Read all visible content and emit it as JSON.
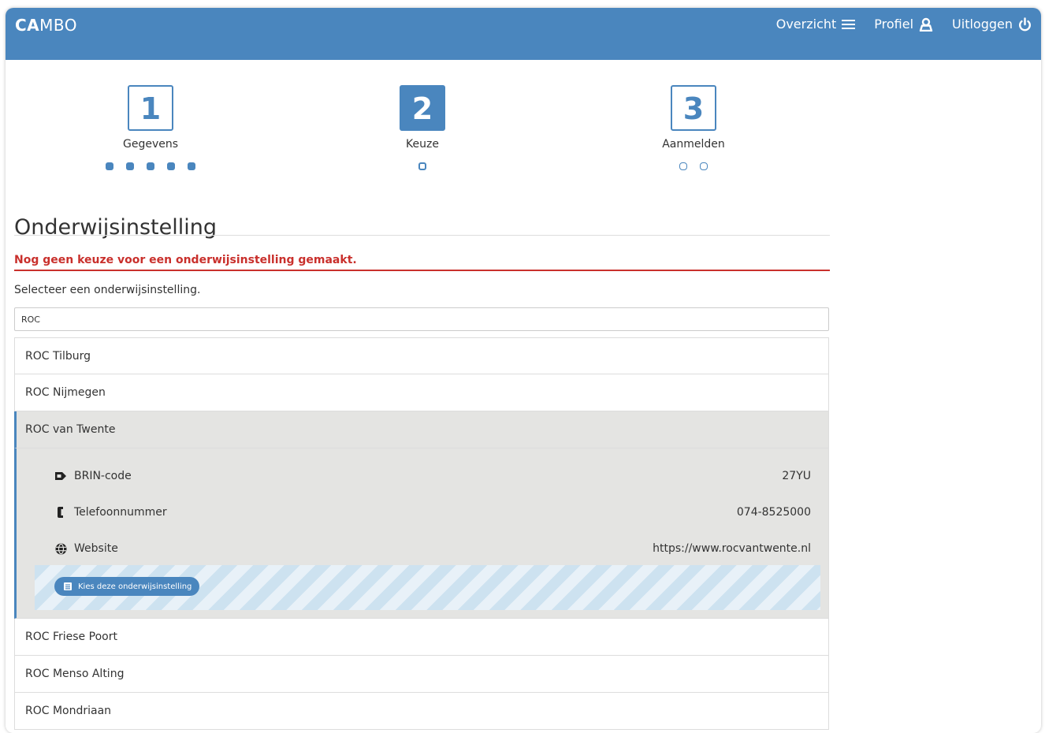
{
  "header": {
    "logo_bold": "CA",
    "logo_rest": "MBO",
    "nav": [
      {
        "label": "Overzicht",
        "icon": "list-icon"
      },
      {
        "label": "Profiel",
        "icon": "user-icon"
      },
      {
        "label": "Uitloggen",
        "icon": "power-icon"
      }
    ]
  },
  "steps": [
    {
      "number": "1",
      "label": "Gegevens",
      "state": "done"
    },
    {
      "number": "2",
      "label": "Keuze",
      "state": "active"
    },
    {
      "number": "3",
      "label": "Aanmelden",
      "state": "upcoming"
    }
  ],
  "main": {
    "title": "Onderwijsinstelling",
    "warning": "Nog geen keuze voor een onderwijsinstelling gemaakt.",
    "instruction": "Selecteer een onderwijsinstelling.",
    "search_value": "ROC"
  },
  "results": [
    {
      "name": "ROC Tilburg"
    },
    {
      "name": "ROC Nijmegen"
    },
    {
      "name": "ROC van Twente",
      "selected": true
    },
    {
      "name": "ROC Friese Poort"
    },
    {
      "name": "ROC Menso Alting"
    },
    {
      "name": "ROC Mondriaan"
    }
  ],
  "selected_details": {
    "brin_label": "BRIN-code",
    "brin_value": "27YU",
    "phone_label": "Telefoonnummer",
    "phone_value": "074-8525000",
    "website_label": "Website",
    "website_value": "https://www.rocvantwente.nl",
    "choose_button": "Kies deze onderwijsinstelling"
  },
  "colors": {
    "accent": "#4a86be",
    "warning": "#c9302c",
    "selected_bg": "#e4e4e2"
  }
}
